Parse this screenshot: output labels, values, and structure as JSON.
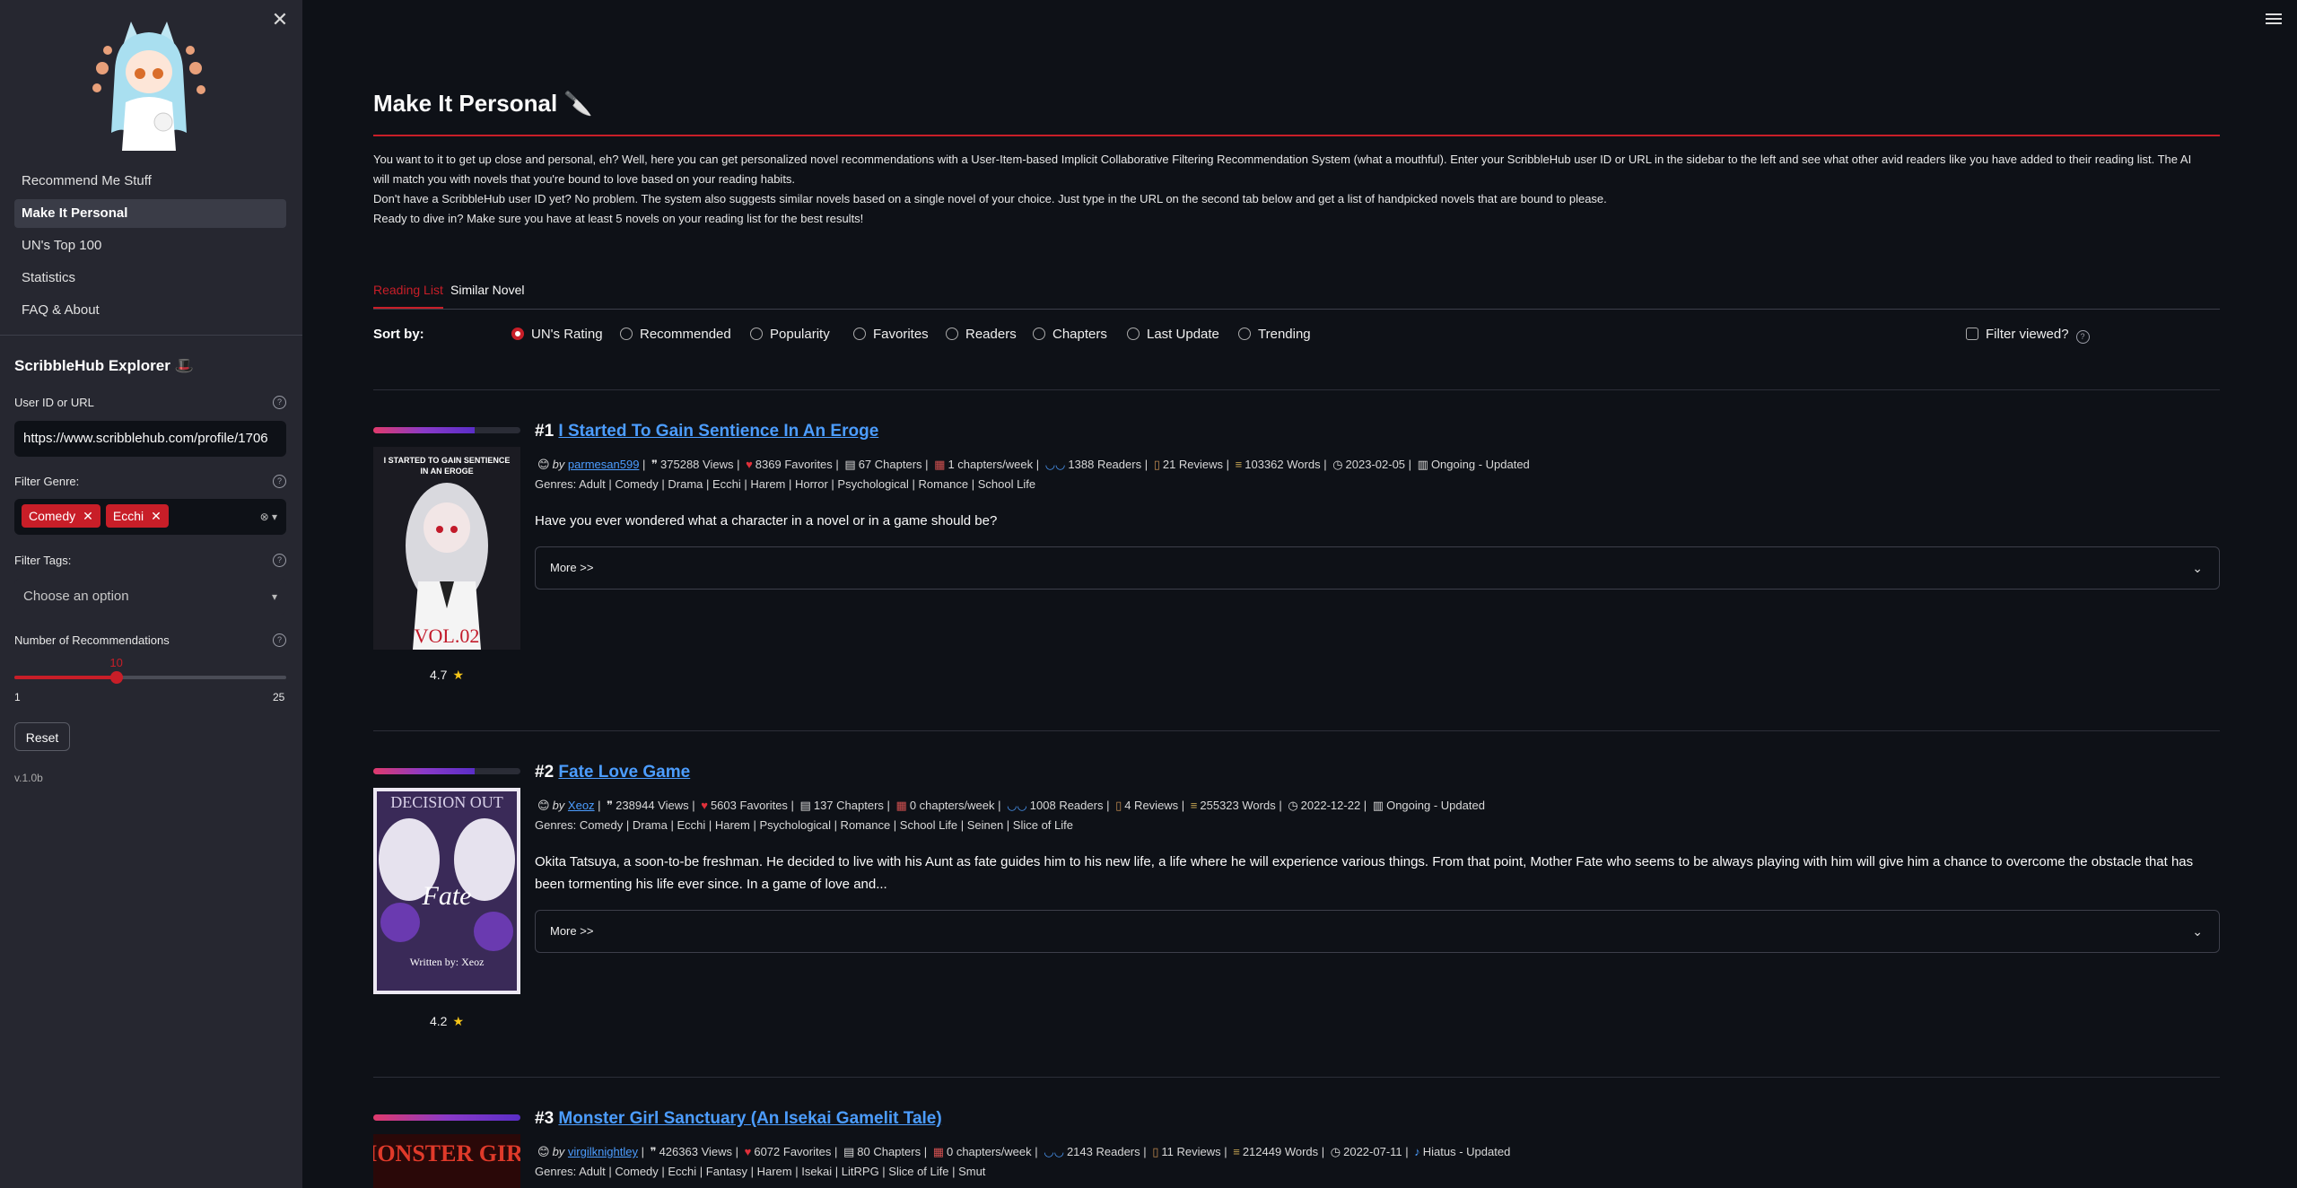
{
  "sidebar": {
    "nav": [
      {
        "label": "Recommend Me Stuff",
        "active": false
      },
      {
        "label": "Make It Personal",
        "active": true
      },
      {
        "label": "UN's Top 100",
        "active": false
      },
      {
        "label": "Statistics",
        "active": false
      },
      {
        "label": "FAQ & About",
        "active": false
      }
    ],
    "explorer_title": "ScribbleHub Explorer 🎩",
    "user_id_label": "User ID or URL",
    "user_id_value": "https://www.scribblehub.com/profile/1706",
    "genre_label": "Filter Genre:",
    "genres_selected": [
      "Comedy",
      "Ecchi"
    ],
    "tags_label": "Filter Tags:",
    "tags_placeholder": "Choose an option",
    "num_label": "Number of Recommendations",
    "num_value": "10",
    "num_min": "1",
    "num_max": "25",
    "reset_label": "Reset",
    "version": "v.1.0b"
  },
  "main": {
    "title": "Make It Personal 🔪",
    "intro": [
      "You want to it to get up close and personal, eh? Well, here you can get personalized novel recommendations with a User-Item-based Implicit Collaborative Filtering Recommendation System (what a mouthful). Enter your ScribbleHub user ID or URL in the sidebar to the left and see what other avid readers like you have added to their reading list. The AI will match you with novels that you're bound to love based on your reading habits.",
      "Don't have a ScribbleHub user ID yet? No problem. The system also suggests similar novels based on a single novel of your choice. Just type in the URL on the second tab below and get a list of handpicked novels that are bound to please.",
      "Ready to dive in? Make sure you have at least 5 novels on your reading list for the best results!"
    ],
    "tabs": [
      "Reading List",
      "Similar Novel"
    ],
    "sort_label": "Sort by:",
    "sort_options": [
      "UN's Rating",
      "Recommended",
      "Popularity",
      "Favorites",
      "Readers",
      "Chapters",
      "Last Update",
      "Trending"
    ],
    "sort_selected": "UN's Rating",
    "filter_viewed_label": "Filter viewed?"
  },
  "novels": [
    {
      "rank": "#1",
      "title": "I Started To Gain Sentience In An Eroge",
      "score_fraction": 0.69,
      "author": "parmesan599",
      "views": "375288 Views",
      "favorites": "8369 Favorites",
      "chapters": "67 Chapters",
      "rate": "1 chapters/week",
      "readers": "1388 Readers",
      "reviews": "21 Reviews",
      "words": "103362 Words",
      "date": "2023-02-05",
      "status": "Ongoing - Updated",
      "genres": "Genres: Adult | Comedy | Drama | Ecchi | Harem | Horror | Psychological | Romance | School Life",
      "description": "Have you ever wondered what a character in a novel or in a game should be?",
      "more": "More >>",
      "rating": "4.7",
      "cover_top": "I STARTED TO GAIN SENTIENCE IN AN EROGE",
      "cover_bottom": "VOL.02"
    },
    {
      "rank": "#2",
      "title": "Fate Love Game",
      "score_fraction": 0.69,
      "author": "Xeoz",
      "views": "238944 Views",
      "favorites": "5603 Favorites",
      "chapters": "137 Chapters",
      "rate": "0 chapters/week",
      "readers": "1008 Readers",
      "reviews": "4 Reviews",
      "words": "255323 Words",
      "date": "2022-12-22",
      "status": "Ongoing - Updated",
      "genres": "Genres: Comedy | Drama | Ecchi | Harem | Psychological | Romance | School Life | Seinen | Slice of Life",
      "description": "Okita Tatsuya, a soon-to-be freshman. He decided to live with his Aunt as fate guides him to his new life, a life where he will experience various things. From that point, Mother Fate who seems to be always playing with him will give him a chance to overcome the obstacle that has been tormenting his life ever since. In a game of love and...",
      "more": "More >>",
      "rating": "4.2",
      "cover_top": "DECISION OUT",
      "cover_bottom": "Written by: Xeoz"
    },
    {
      "rank": "#3",
      "title": "Monster Girl Sanctuary (An Isekai Gamelit Tale)",
      "score_fraction": 1.0,
      "author": "virgilknightley",
      "views": "426363 Views",
      "favorites": "6072 Favorites",
      "chapters": "80 Chapters",
      "rate": "0 chapters/week",
      "readers": "2143 Readers",
      "reviews": "11 Reviews",
      "words": "212449 Words",
      "date": "2022-07-11",
      "status": "Hiatus - Updated",
      "genres": "Genres: Adult | Comedy | Ecchi | Fantasy | Harem | Isekai | LitRPG | Slice of Life | Smut",
      "cover_top": "MONSTER GIRL"
    }
  ]
}
